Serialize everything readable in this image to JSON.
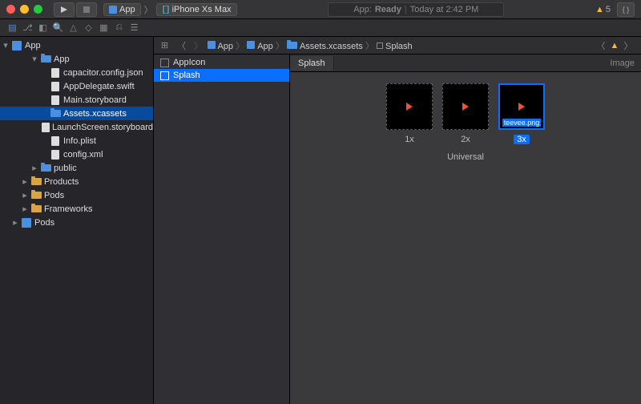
{
  "titlebar": {
    "scheme_app": "App",
    "scheme_device": "iPhone Xs Max",
    "status_prefix": "App:",
    "status_state": "Ready",
    "status_time": "Today at 2:42 PM",
    "warning_count": "5",
    "curly_label": "{ }"
  },
  "navigator": {
    "root": "App",
    "items": [
      {
        "label": "App",
        "indent": 1,
        "type": "folder-blue",
        "open": true
      },
      {
        "label": "capacitor.config.json",
        "indent": 2,
        "type": "json"
      },
      {
        "label": "AppDelegate.swift",
        "indent": 2,
        "type": "swift"
      },
      {
        "label": "Main.storyboard",
        "indent": 2,
        "type": "sb"
      },
      {
        "label": "Assets.xcassets",
        "indent": 2,
        "type": "folder-blue",
        "selected": true
      },
      {
        "label": "LaunchScreen.storyboard",
        "indent": 2,
        "type": "sb"
      },
      {
        "label": "Info.plist",
        "indent": 2,
        "type": "plist"
      },
      {
        "label": "config.xml",
        "indent": 2,
        "type": "xml"
      },
      {
        "label": "public",
        "indent": 1,
        "type": "folder-blue",
        "closed": true
      },
      {
        "label": "Products",
        "indent": 0,
        "type": "folder-yellow",
        "closed": true
      },
      {
        "label": "Pods",
        "indent": 0,
        "type": "folder-yellow",
        "closed": true
      },
      {
        "label": "Frameworks",
        "indent": 0,
        "type": "folder-yellow",
        "closed": true
      },
      {
        "label": "Pods",
        "indent": -1,
        "type": "proj",
        "closed": true
      }
    ]
  },
  "crumbs": [
    "App",
    "App",
    "Assets.xcassets",
    "Splash"
  ],
  "assetlist": {
    "items": [
      {
        "label": "AppIcon"
      },
      {
        "label": "Splash",
        "selected": true
      }
    ]
  },
  "editor": {
    "tab": "Splash",
    "kind": "Image",
    "slots": [
      "1x",
      "2x",
      "3x"
    ],
    "selected_file": "teevee.png",
    "set_label": "Universal"
  }
}
